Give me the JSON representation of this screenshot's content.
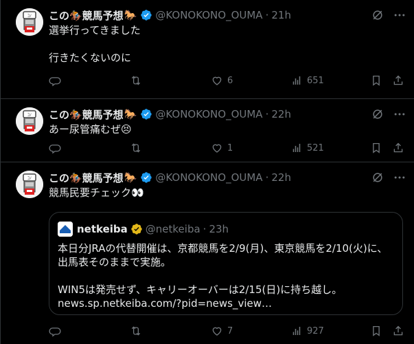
{
  "tweets": [
    {
      "author_name": "この🏇競馬予想",
      "author_emoji": "🐎",
      "handle": "@KONOKONO_OUMA",
      "time": "21h",
      "text": "選挙行ってきました\n\n行きたくないのに",
      "replies": "",
      "retweets": "",
      "likes": "6",
      "views": "651"
    },
    {
      "author_name": "この🏇競馬予想",
      "author_emoji": "🐎",
      "handle": "@KONOKONO_OUMA",
      "time": "22h",
      "text": "あー尿管痛むぜ😣",
      "replies": "",
      "retweets": "",
      "likes": "1",
      "views": "521"
    },
    {
      "author_name": "この🏇競馬予想",
      "author_emoji": "🐎",
      "handle": "@KONOKONO_OUMA",
      "time": "22h",
      "text": "競馬民要チェック👀",
      "quote": {
        "name": "netkeiba",
        "handle": "@netkeiba",
        "time": "23h",
        "text": "本日分JRAの代替開催は、京都競馬を2/9(月)、東京競馬を2/10(火)に、\n出馬表そのままで実施。\n\nWIN5は発売せず、キャリーオーバーは2/15(日)に持ち越し。\nnews.sp.netkeiba.com/?pid=news_view…"
      },
      "replies": "",
      "retweets": "",
      "likes": "7",
      "views": "927"
    }
  ],
  "colors": {
    "background": "#000000",
    "text": "#e7e9ea",
    "muted": "#71767b",
    "border": "#2f3336",
    "verified_blue": "#1d9bf0",
    "verified_gold": "#e2b719"
  }
}
